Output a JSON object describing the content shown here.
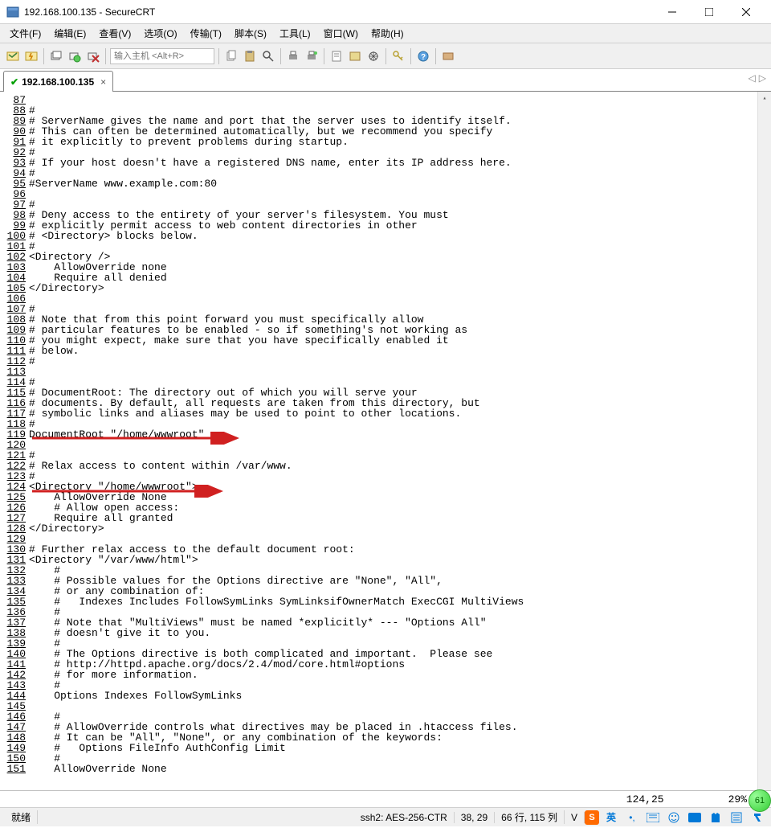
{
  "window": {
    "title": "192.168.100.135 - SecureCRT"
  },
  "menu": {
    "items": [
      "文件(F)",
      "编辑(E)",
      "查看(V)",
      "选项(O)",
      "传输(T)",
      "脚本(S)",
      "工具(L)",
      "窗口(W)",
      "帮助(H)"
    ]
  },
  "toolbar": {
    "host_placeholder": "输入主机 <Alt+R>"
  },
  "tab": {
    "label": "192.168.100.135",
    "close": "×"
  },
  "lines": [
    {
      "n": "87",
      "t": ""
    },
    {
      "n": "88",
      "t": "#"
    },
    {
      "n": "89",
      "t": "# ServerName gives the name and port that the server uses to identify itself."
    },
    {
      "n": "90",
      "t": "# This can often be determined automatically, but we recommend you specify"
    },
    {
      "n": "91",
      "t": "# it explicitly to prevent problems during startup."
    },
    {
      "n": "92",
      "t": "#"
    },
    {
      "n": "93",
      "t": "# If your host doesn't have a registered DNS name, enter its IP address here."
    },
    {
      "n": "94",
      "t": "#"
    },
    {
      "n": "95",
      "t": "#ServerName www.example.com:80"
    },
    {
      "n": "96",
      "t": ""
    },
    {
      "n": "97",
      "t": "#"
    },
    {
      "n": "98",
      "t": "# Deny access to the entirety of your server's filesystem. You must"
    },
    {
      "n": "99",
      "t": "# explicitly permit access to web content directories in other"
    },
    {
      "n": "100",
      "t": "# <Directory> blocks below."
    },
    {
      "n": "101",
      "t": "#"
    },
    {
      "n": "102",
      "t": "<Directory />"
    },
    {
      "n": "103",
      "t": "    AllowOverride none"
    },
    {
      "n": "104",
      "t": "    Require all denied"
    },
    {
      "n": "105",
      "t": "</Directory>"
    },
    {
      "n": "106",
      "t": ""
    },
    {
      "n": "107",
      "t": "#"
    },
    {
      "n": "108",
      "t": "# Note that from this point forward you must specifically allow"
    },
    {
      "n": "109",
      "t": "# particular features to be enabled - so if something's not working as"
    },
    {
      "n": "110",
      "t": "# you might expect, make sure that you have specifically enabled it"
    },
    {
      "n": "111",
      "t": "# below."
    },
    {
      "n": "112",
      "t": "#"
    },
    {
      "n": "113",
      "t": ""
    },
    {
      "n": "114",
      "t": "#"
    },
    {
      "n": "115",
      "t": "# DocumentRoot: The directory out of which you will serve your"
    },
    {
      "n": "116",
      "t": "# documents. By default, all requests are taken from this directory, but"
    },
    {
      "n": "117",
      "t": "# symbolic links and aliases may be used to point to other locations."
    },
    {
      "n": "118",
      "t": "#"
    },
    {
      "n": "119",
      "t": "DocumentRoot \"/home/wwwroot\""
    },
    {
      "n": "120",
      "t": ""
    },
    {
      "n": "121",
      "t": "#"
    },
    {
      "n": "122",
      "t": "# Relax access to content within /var/www."
    },
    {
      "n": "123",
      "t": "#"
    },
    {
      "n": "124",
      "t": "<Directory \"/home/wwwroot\">"
    },
    {
      "n": "125",
      "t": "    AllowOverride None"
    },
    {
      "n": "126",
      "t": "    # Allow open access:"
    },
    {
      "n": "127",
      "t": "    Require all granted"
    },
    {
      "n": "128",
      "t": "</Directory>"
    },
    {
      "n": "129",
      "t": ""
    },
    {
      "n": "130",
      "t": "# Further relax access to the default document root:"
    },
    {
      "n": "131",
      "t": "<Directory \"/var/www/html\">"
    },
    {
      "n": "132",
      "t": "    #"
    },
    {
      "n": "133",
      "t": "    # Possible values for the Options directive are \"None\", \"All\","
    },
    {
      "n": "134",
      "t": "    # or any combination of:"
    },
    {
      "n": "135",
      "t": "    #   Indexes Includes FollowSymLinks SymLinksifOwnerMatch ExecCGI MultiViews"
    },
    {
      "n": "136",
      "t": "    #"
    },
    {
      "n": "137",
      "t": "    # Note that \"MultiViews\" must be named *explicitly* --- \"Options All\""
    },
    {
      "n": "138",
      "t": "    # doesn't give it to you."
    },
    {
      "n": "139",
      "t": "    #"
    },
    {
      "n": "140",
      "t": "    # The Options directive is both complicated and important.  Please see"
    },
    {
      "n": "141",
      "t": "    # http://httpd.apache.org/docs/2.4/mod/core.html#options"
    },
    {
      "n": "142",
      "t": "    # for more information."
    },
    {
      "n": "143",
      "t": "    #"
    },
    {
      "n": "144",
      "t": "    Options Indexes FollowSymLinks"
    },
    {
      "n": "145",
      "t": ""
    },
    {
      "n": "146",
      "t": "    #"
    },
    {
      "n": "147",
      "t": "    # AllowOverride controls what directives may be placed in .htaccess files."
    },
    {
      "n": "148",
      "t": "    # It can be \"All\", \"None\", or any combination of the keywords:"
    },
    {
      "n": "149",
      "t": "    #   Options FileInfo AuthConfig Limit"
    },
    {
      "n": "150",
      "t": "    #"
    },
    {
      "n": "151",
      "t": "    AllowOverride None"
    }
  ],
  "term_status": {
    "pos": "124,25",
    "pct": "29%"
  },
  "status": {
    "ready": "就绪",
    "proto": "ssh2: AES-256-CTR",
    "cursor": "38, 29",
    "size": "66 行, 115 列",
    "vt": "V",
    "ime_zh": "英",
    "badge": "61"
  }
}
